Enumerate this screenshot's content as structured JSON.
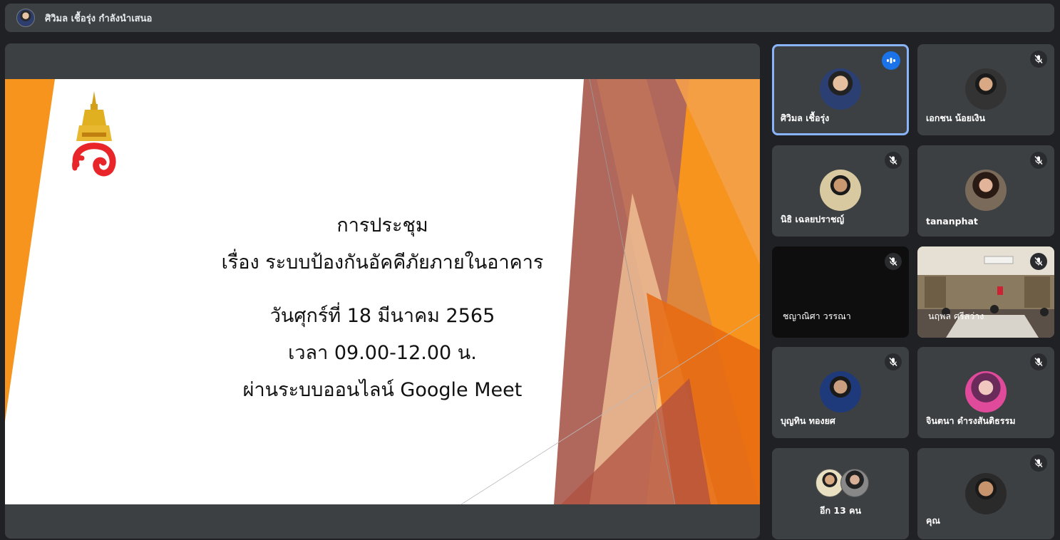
{
  "presenter_bar": {
    "text": "ศิวิมล เชื้อรุ่ง กำลังนำเสนอ"
  },
  "slide": {
    "title": "การประชุม",
    "subject": "เรื่อง ระบบป้องกันอัคคีภัยภายในอาคาร",
    "date": "วันศุกร์ที่ 18 มีนาคม 2565",
    "time": "เวลา 09.00-12.00 น.",
    "platform": "ผ่านระบบออนไลน์ Google Meet"
  },
  "colors": {
    "background": "#202124",
    "tile": "#3c4043",
    "active_border": "#8ab4f8",
    "speaking_badge": "#1a73e8",
    "slide_orange": "#f7941d",
    "slide_brown": "#a8584a"
  },
  "participants": [
    {
      "name": "ศิวิมล เชื้อรุ่ง",
      "speaking": true,
      "icon": "audio-bars-icon"
    },
    {
      "name": "เอกชน น้อยเงิน",
      "muted": true,
      "icon": "mic-off-icon"
    },
    {
      "name": "นิธิ เฉลยปราชญ์",
      "muted": true,
      "icon": "mic-off-icon"
    },
    {
      "name": "tananphat",
      "muted": true,
      "icon": "mic-off-icon"
    },
    {
      "name": "ชญาณิศา วรรณา",
      "muted": true,
      "icon": "mic-off-icon"
    },
    {
      "name": "นฤพล ศรีสว่าง",
      "muted": true,
      "icon": "mic-off-icon"
    },
    {
      "name": "บุญทิน ทองยศ",
      "muted": true,
      "icon": "mic-off-icon"
    },
    {
      "name": "จินตนา ดำรงสันติธรรม",
      "muted": true,
      "icon": "mic-off-icon"
    },
    {
      "name": "อีก 13 คน"
    },
    {
      "name": "คุณ",
      "muted": true,
      "icon": "mic-off-icon"
    }
  ]
}
